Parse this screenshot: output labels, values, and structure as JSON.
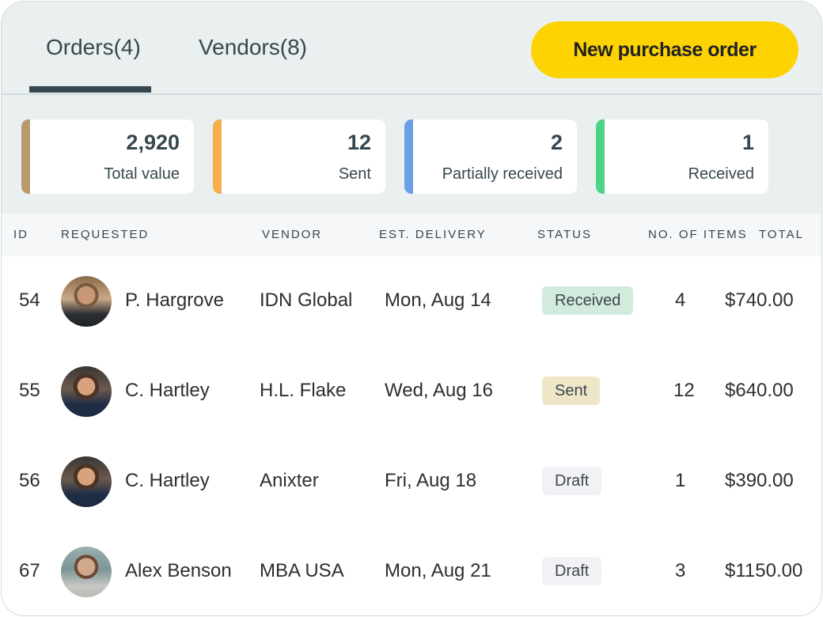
{
  "tabs": [
    {
      "label": "Orders(4)",
      "active": true
    },
    {
      "label": "Vendors(8)",
      "active": false
    }
  ],
  "actions": {
    "new_order_label": "New purchase order",
    "accent": "#fdd304"
  },
  "stats": [
    {
      "value": "2,920",
      "label": "Total value",
      "color": "#b89a6e"
    },
    {
      "value": "12",
      "label": "Sent",
      "color": "#f6ad4b"
    },
    {
      "value": "2",
      "label": "Partially received",
      "color": "#6a9ee6"
    },
    {
      "value": "1",
      "label": "Received",
      "color": "#4cd386"
    }
  ],
  "table": {
    "columns": [
      "ID",
      "REQUESTED",
      "VENDOR",
      "EST. DELIVERY",
      "STATUS",
      "NO. OF ITEMS",
      "TOTAL"
    ],
    "rows": [
      {
        "id": "54",
        "avatar": "avatar-p-hargrove",
        "requested": "P. Hargrove",
        "vendor": "IDN Global",
        "delivery": "Mon, Aug 14",
        "status": "Received",
        "status_key": "received",
        "items": "4",
        "total": "$740.00"
      },
      {
        "id": "55",
        "avatar": "avatar-c-hartley",
        "requested": "C. Hartley",
        "vendor": "H.L. Flake",
        "delivery": "Wed, Aug 16",
        "status": "Sent",
        "status_key": "sent",
        "items": "12",
        "total": "$640.00"
      },
      {
        "id": "56",
        "avatar": "avatar-c-hartley",
        "requested": "C. Hartley",
        "vendor": "Anixter",
        "delivery": "Fri, Aug 18",
        "status": "Draft",
        "status_key": "draft",
        "items": "1",
        "total": "$390.00"
      },
      {
        "id": "67",
        "avatar": "avatar-alex-benson",
        "requested": "Alex Benson",
        "vendor": "MBA USA",
        "delivery": "Mon, Aug 21",
        "status": "Draft",
        "status_key": "draft",
        "items": "3",
        "total": "$1150.00"
      }
    ]
  }
}
